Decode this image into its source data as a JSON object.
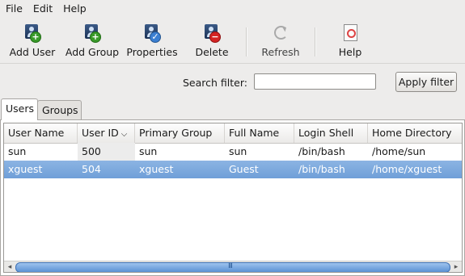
{
  "menu": [
    "File",
    "Edit",
    "Help"
  ],
  "toolbar": {
    "add_user": "Add User",
    "add_group": "Add Group",
    "properties": "Properties",
    "delete": "Delete",
    "refresh": "Refresh",
    "help": "Help"
  },
  "filter": {
    "label": "Search filter:",
    "value": "",
    "apply_label": "Apply filter"
  },
  "tabs": [
    "Users",
    "Groups"
  ],
  "table": {
    "columns": [
      "User Name",
      "User ID",
      "Primary Group",
      "Full Name",
      "Login Shell",
      "Home Directory"
    ],
    "sorted_column": "User ID",
    "rows": [
      [
        "sun",
        "500",
        "sun",
        "sun",
        "/bin/bash",
        "/home/sun"
      ],
      [
        "xguest",
        "504",
        "xguest",
        "Guest",
        "/bin/bash",
        "/home/xguest"
      ]
    ],
    "selected_row": 1
  },
  "scrollbar": {
    "grip": "III"
  },
  "colors": {
    "selection": "#7aa7dd",
    "window_bg": "#edeceb"
  }
}
